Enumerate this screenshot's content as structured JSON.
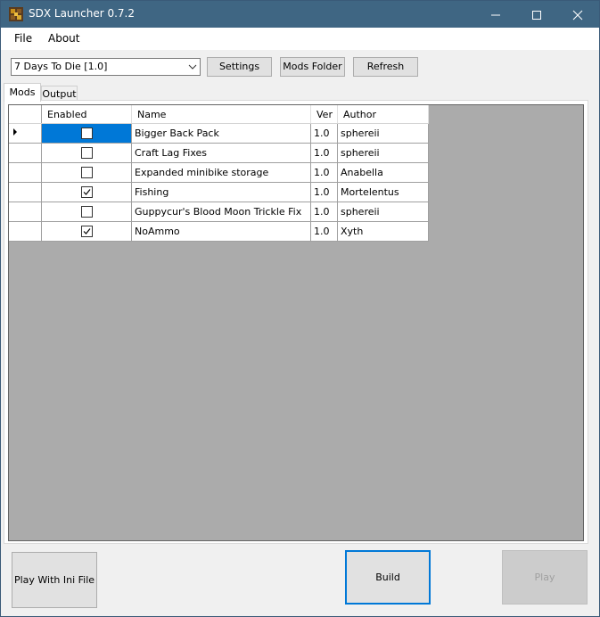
{
  "window": {
    "title": "SDX Launcher 0.7.2",
    "controls": [
      "minimize-icon",
      "maximize-icon",
      "close-icon"
    ]
  },
  "colors": {
    "titlebar": "#3f6683",
    "selection": "#0078d7",
    "grid_background": "#ababab",
    "button_face": "#e1e1e1"
  },
  "menu": {
    "file": "File",
    "about": "About"
  },
  "toolbar": {
    "game_select": "7 Days To Die [1.0]",
    "settings_label": "Settings",
    "mods_folder_label": "Mods Folder",
    "refresh_label": "Refresh"
  },
  "tabs": {
    "mods": "Mods",
    "output": "Output"
  },
  "grid": {
    "columns": {
      "enabled": "Enabled",
      "name": "Name",
      "ver": "Ver",
      "author": "Author"
    },
    "rows": [
      {
        "enabled": false,
        "name": "Bigger Back Pack",
        "ver": "1.0",
        "author": "sphereii",
        "current": true
      },
      {
        "enabled": false,
        "name": "Craft Lag Fixes",
        "ver": "1.0",
        "author": "sphereii",
        "current": false
      },
      {
        "enabled": false,
        "name": "Expanded minibike storage",
        "ver": "1.0",
        "author": "Anabella",
        "current": false
      },
      {
        "enabled": true,
        "name": "Fishing",
        "ver": "1.0",
        "author": "Mortelentus",
        "current": false
      },
      {
        "enabled": false,
        "name": "Guppycur's Blood Moon Trickle Fix",
        "ver": "1.0",
        "author": "sphereii",
        "current": false
      },
      {
        "enabled": true,
        "name": "NoAmmo",
        "ver": "1.0",
        "author": "Xyth",
        "current": false
      }
    ]
  },
  "footer": {
    "play_with_ini_label": "Play With Ini File",
    "build_label": "Build",
    "play_label": "Play"
  }
}
